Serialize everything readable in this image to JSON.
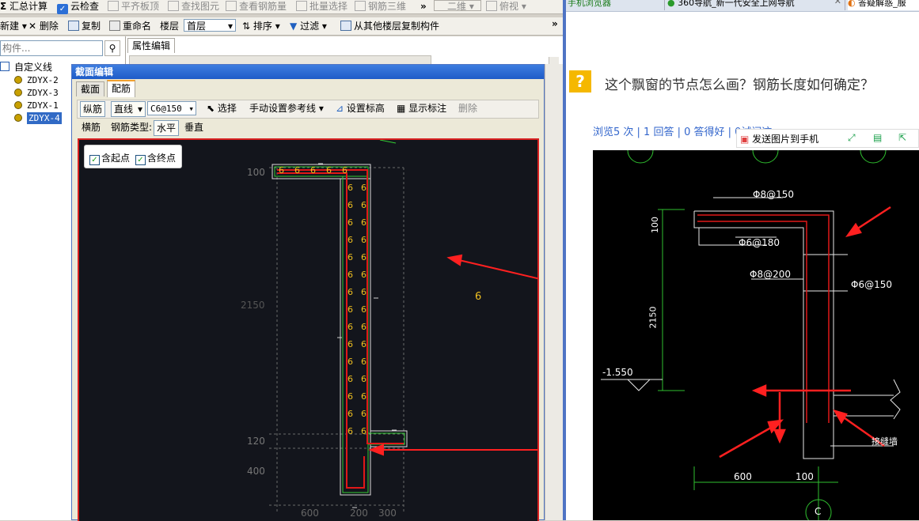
{
  "toolbar1": {
    "summary": "汇总计算",
    "cloud_check": "云检查",
    "flat_slab": "平齐板顶",
    "find_element": "查找图元",
    "view_rebar": "查看钢筋量",
    "batch_select": "批量选择",
    "rebar_3d": "钢筋三维",
    "view_mode": "二维",
    "view_angle": "俯视"
  },
  "toolbar2": {
    "new": "新建",
    "delete": "删除",
    "copy": "复制",
    "rename": "重命名",
    "floor_label": "楼层",
    "floor_value": "首层",
    "sort": "排序",
    "filter": "过滤",
    "copy_from_floor": "从其他楼层复制构件"
  },
  "left_panel": {
    "search_placeholder": "构件...",
    "tree_root": "自定义线",
    "items": [
      "ZDYX-2",
      "ZDYX-3",
      "ZDYX-1",
      "ZDYX-4"
    ]
  },
  "props_tab": "属性编辑",
  "dialog": {
    "title": "截面编辑",
    "tabs": [
      "截面",
      "配筋"
    ],
    "row1": {
      "longitudinal": "纵筋",
      "line": "直线",
      "spec": "C6@150",
      "select": "选择",
      "manual_ref": "手动设置参考线",
      "set_elev": "设置标高",
      "show_label": "显示标注",
      "delete": "删除"
    },
    "row2": {
      "transverse": "横筋",
      "type_label": "钢筋类型:",
      "horizontal": "水平",
      "vertical": "垂直"
    },
    "canvas": {
      "chk_start": "含起点",
      "chk_end": "含终点",
      "dims_left": [
        "100",
        "2150",
        "120",
        "400"
      ],
      "dims_bottom": [
        "600",
        "200",
        "300"
      ],
      "rebar_mark": "6",
      "float_label": "6",
      "colors": {
        "bg": "#13151c",
        "rebar": "#e01818",
        "outline": "#dcdcdc",
        "green": "#33cc33",
        "mark": "#f0c020"
      }
    }
  },
  "browser": {
    "tabs": [
      "手机浏览器",
      "360导航_新一代安全上网导航",
      "答疑解惑_服"
    ],
    "question": "这个飘窗的节点怎么画？钢筋长度如何确定？",
    "stats": "浏览5 次 | 1 回答 | 0 答得好 | 0试问这",
    "send_phone": "发送图片到手机",
    "drawing": {
      "labels": [
        "Φ8@150",
        "Φ6@180",
        "Φ8@200",
        "Φ6@150",
        "100",
        "2150",
        "-1.550",
        "600",
        "100",
        "接缝墙",
        "C"
      ]
    }
  }
}
